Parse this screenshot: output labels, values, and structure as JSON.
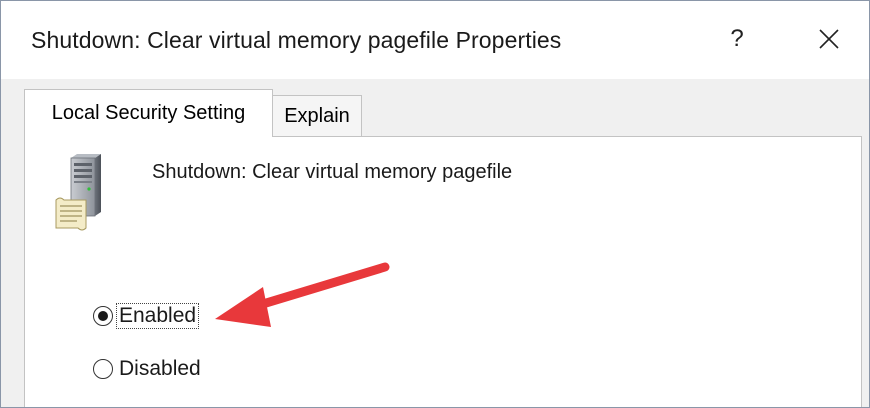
{
  "window": {
    "title": "Shutdown: Clear virtual memory pagefile Properties",
    "help_label": "?",
    "close_icon": "close-icon"
  },
  "tabs": [
    {
      "label": "Local Security Setting",
      "selected": true
    },
    {
      "label": "Explain",
      "selected": false
    }
  ],
  "policy": {
    "icon": "server-policy-icon",
    "name": "Shutdown: Clear virtual memory pagefile"
  },
  "options": {
    "enabled": {
      "label": "Enabled",
      "checked": true
    },
    "disabled": {
      "label": "Disabled",
      "checked": false
    }
  },
  "annotation": {
    "arrow_color": "#e8383b",
    "points_to": "Enabled"
  }
}
